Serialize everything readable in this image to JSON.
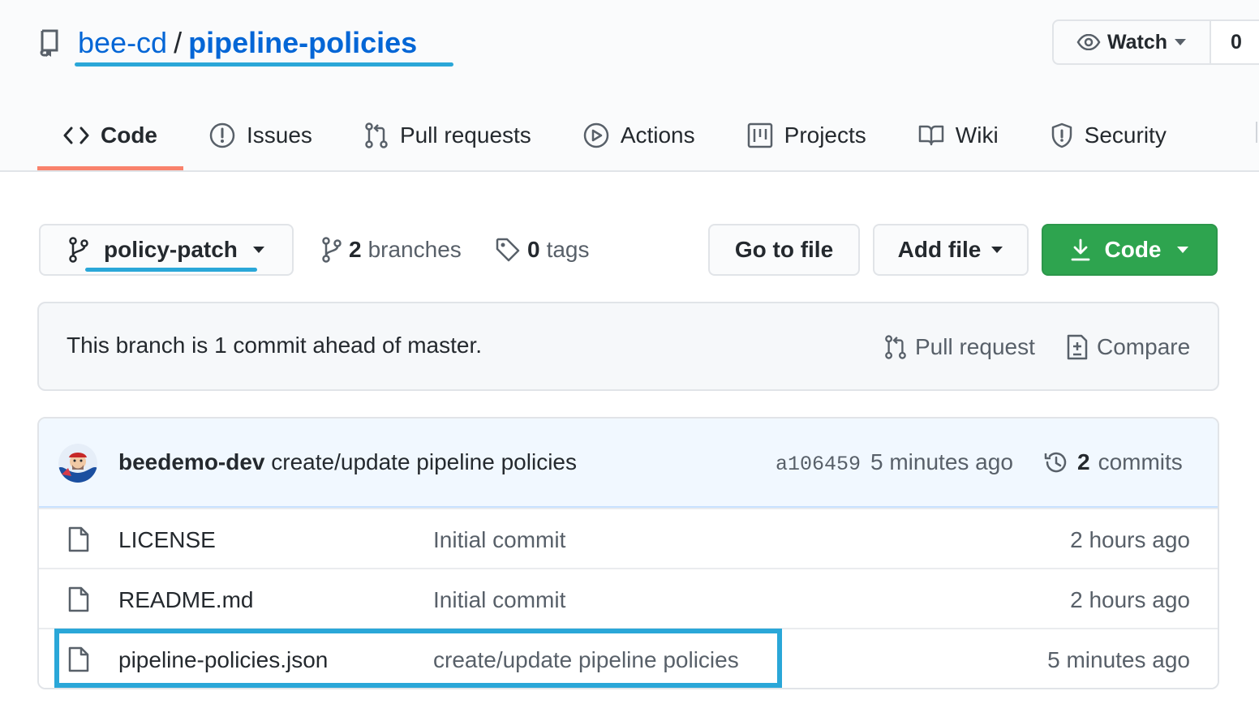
{
  "repo": {
    "owner": "bee-cd",
    "separator": "/",
    "name": "pipeline-policies"
  },
  "watch": {
    "label": "Watch",
    "count": "0"
  },
  "tabs": [
    {
      "label": "Code",
      "icon": "code-icon",
      "selected": true
    },
    {
      "label": "Issues",
      "icon": "issue-icon"
    },
    {
      "label": "Pull requests",
      "icon": "pull-request-icon"
    },
    {
      "label": "Actions",
      "icon": "play-icon"
    },
    {
      "label": "Projects",
      "icon": "project-icon"
    },
    {
      "label": "Wiki",
      "icon": "book-icon"
    },
    {
      "label": "Security",
      "icon": "shield-icon"
    }
  ],
  "branch": {
    "current": "policy-patch",
    "branches_count": "2",
    "branches_label": "branches",
    "tags_count": "0",
    "tags_label": "tags"
  },
  "actions": {
    "go_to_file": "Go to file",
    "add_file": "Add file",
    "code": "Code"
  },
  "ahead": {
    "message": "This branch is 1 commit ahead of master.",
    "pull_request": "Pull request",
    "compare": "Compare"
  },
  "latest_commit": {
    "author": "beedemo-dev",
    "message": "create/update pipeline policies",
    "sha": "a106459",
    "time": "5 minutes ago",
    "commits_count": "2",
    "commits_label": "commits"
  },
  "files": [
    {
      "name": "LICENSE",
      "commit": "Initial commit",
      "time": "2 hours ago"
    },
    {
      "name": "README.md",
      "commit": "Initial commit",
      "time": "2 hours ago"
    },
    {
      "name": "pipeline-policies.json",
      "commit": "create/update pipeline policies",
      "time": "5 minutes ago"
    }
  ],
  "colors": {
    "link": "#0366d6",
    "selected_tab_border": "#f9826c",
    "code_button": "#2ea44f",
    "annotation": "#2aa7d8"
  }
}
